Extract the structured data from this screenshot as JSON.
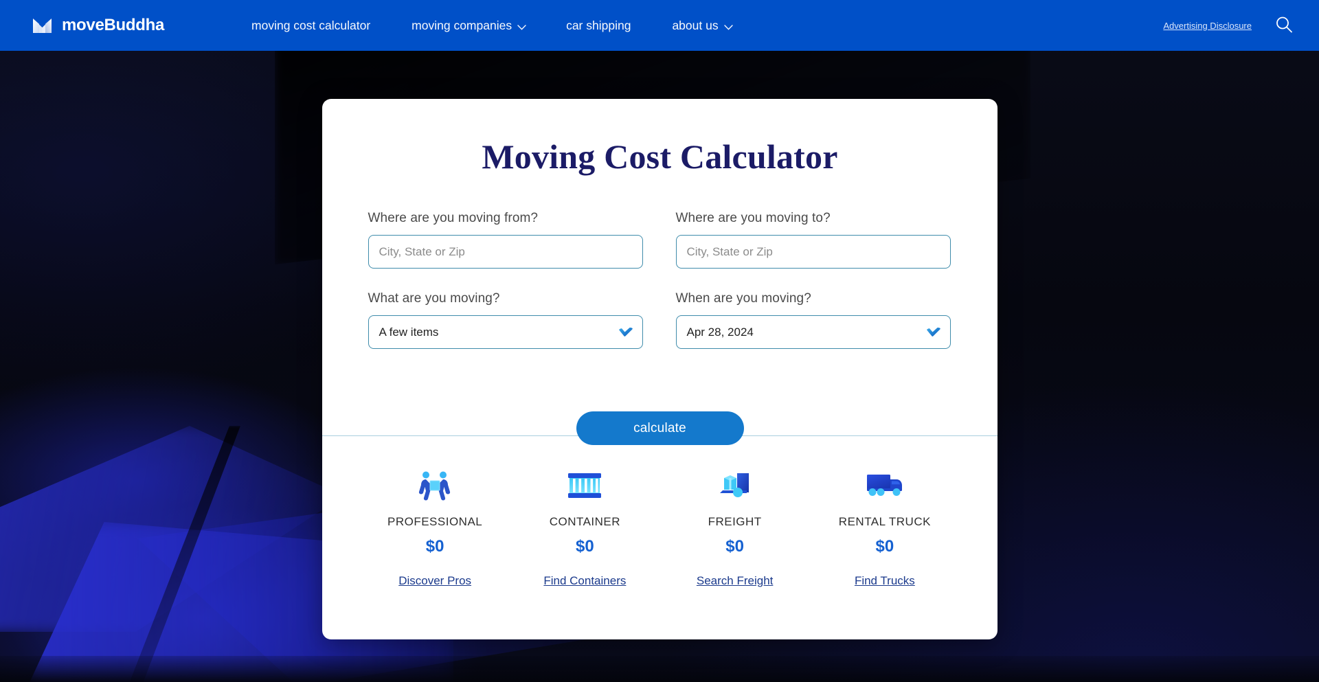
{
  "nav": {
    "brand_name": "moveBuddha",
    "logo_icon": "movebuddha-m-logo-icon",
    "links": [
      {
        "label": "moving cost calculator",
        "has_caret": false
      },
      {
        "label": "moving companies",
        "has_caret": true
      },
      {
        "label": "car shipping",
        "has_caret": false
      },
      {
        "label": "about us",
        "has_caret": true
      }
    ],
    "advertising_disclosure": "Advertising Disclosure",
    "search_icon": "search-icon",
    "bar_color": "#0050c8"
  },
  "card": {
    "title": "Moving Cost Calculator",
    "title_color": "#1b1b66",
    "fields": {
      "from": {
        "label": "Where are you moving from?",
        "placeholder": "City, State or Zip",
        "value": ""
      },
      "to": {
        "label": "Where are you moving to?",
        "placeholder": "City, State or Zip",
        "value": ""
      },
      "what": {
        "label": "What are you moving?",
        "value": "A few items"
      },
      "when": {
        "label": "When are you moving?",
        "value": "Apr 28, 2024"
      }
    },
    "calculate_button": "calculate",
    "accent_color": "#1479cc",
    "border_color": "#3f8cab"
  },
  "results": [
    {
      "icon": "movers-carrying-box-icon",
      "label": "PROFESSIONAL",
      "price": "$0",
      "link": "Discover Pros"
    },
    {
      "icon": "shipping-container-icon",
      "label": "CONTAINER",
      "price": "$0",
      "link": "Find Containers"
    },
    {
      "icon": "freight-dolly-icon",
      "label": "FREIGHT",
      "price": "$0",
      "link": "Search Freight"
    },
    {
      "icon": "rental-truck-icon",
      "label": "RENTAL TRUCK",
      "price": "$0",
      "link": "Find Trucks"
    }
  ]
}
